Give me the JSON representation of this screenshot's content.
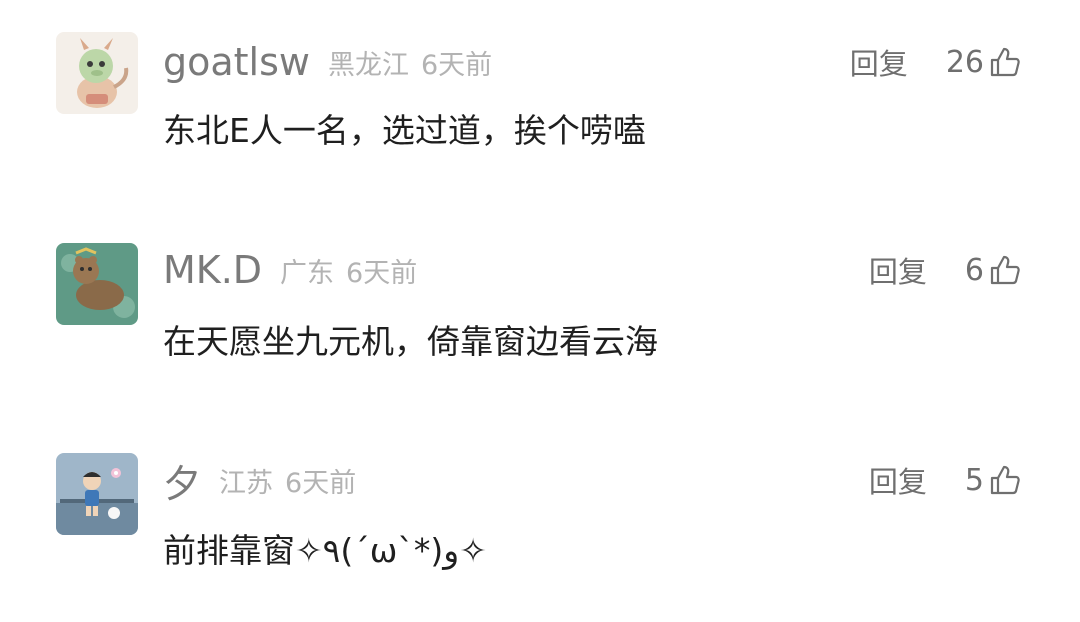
{
  "comments": [
    {
      "username": "goatlsw",
      "location": "黑龙江",
      "time": "6天前",
      "text": "东北E人一名，选过道，挨个唠嗑",
      "reply_label": "回复",
      "likes": "26",
      "avatar_icon": "dragon-avatar-icon"
    },
    {
      "username": "MK.D",
      "location": "广东",
      "time": "6天前",
      "text": "在天愿坐九元机，倚靠窗边看云海",
      "reply_label": "回复",
      "likes": "6",
      "avatar_icon": "bear-avatar-icon"
    },
    {
      "username": "夕",
      "location": "江苏",
      "time": "6天前",
      "text": "前排靠窗✧٩(ˊωˋ*)و✧",
      "reply_label": "回复",
      "likes": "5",
      "avatar_icon": "cartoon-avatar-icon"
    }
  ],
  "colors": {
    "username": "#7a7a7a",
    "meta": "#b3b3b3",
    "text": "#1f1f1f",
    "action": "#6f6f6f"
  },
  "icons": {
    "like": "thumbs-up-icon"
  }
}
